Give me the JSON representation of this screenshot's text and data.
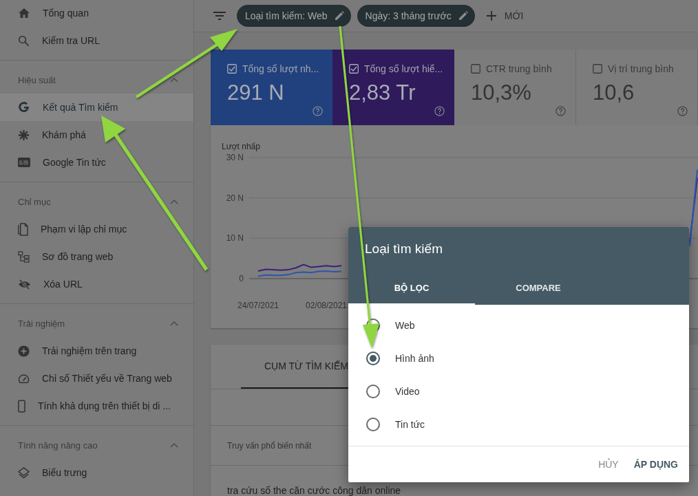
{
  "sidebar": {
    "sections": [
      {
        "items": [
          {
            "label": "Tổng quan",
            "kind": "home",
            "selected": false
          },
          {
            "label": "Kiểm tra URL",
            "kind": "search",
            "selected": false
          }
        ]
      },
      {
        "title": "Hiệu suất",
        "expanded": true,
        "items": [
          {
            "label": "Kết quả Tìm kiếm",
            "kind": "google",
            "selected": true
          },
          {
            "label": "Khám phá",
            "kind": "asterisk",
            "selected": false
          },
          {
            "label": "Google Tin tức",
            "kind": "news",
            "selected": false
          }
        ]
      },
      {
        "title": "Chỉ mục",
        "expanded": true,
        "items": [
          {
            "label": "Phạm vi lập chỉ mục",
            "kind": "pages",
            "selected": false
          },
          {
            "label": "Sơ đồ trang web",
            "kind": "sitemap",
            "selected": false
          },
          {
            "label": "Xóa URL",
            "kind": "eye-off",
            "selected": false
          }
        ]
      },
      {
        "title": "Trải nghiệm",
        "expanded": true,
        "items": [
          {
            "label": "Trải nghiệm trên trang",
            "kind": "experience",
            "selected": false
          },
          {
            "label": "Chỉ số Thiết yếu về Trang web",
            "kind": "gauge",
            "selected": false
          },
          {
            "label": "Tính khả dụng trên thiết bị di ...",
            "kind": "phone",
            "selected": false
          }
        ]
      },
      {
        "title": "Tính năng nâng cao",
        "expanded": true,
        "items": [
          {
            "label": "Biểu trưng",
            "kind": "layers",
            "selected": false
          }
        ]
      }
    ]
  },
  "toolbar": {
    "chips": [
      {
        "label": "Loại tìm kiếm: Web"
      },
      {
        "label": "Ngày: 3 tháng trước"
      }
    ],
    "new_button": "MỚI"
  },
  "metrics": [
    {
      "label": "Tổng số lượt nh...",
      "value": "291 N",
      "checked": true,
      "color": "#21417e"
    },
    {
      "label": "Tổng số lượt hiể...",
      "value": "2,83 Tr",
      "checked": true,
      "color": "#2f1a5c"
    },
    {
      "label": "CTR trung bình",
      "value": "10,3%",
      "checked": false
    },
    {
      "label": "Vị trí trung bình",
      "value": "10,6",
      "checked": false
    }
  ],
  "chart": {
    "chart_data": {
      "type": "line",
      "ylabel": "Lượt nhấp",
      "categories": [
        "24/07/2021",
        null,
        null,
        null,
        null,
        null,
        null,
        null,
        null,
        "02/08/2021",
        null,
        null,
        null,
        null,
        null,
        null,
        null,
        null,
        null,
        null,
        null,
        null,
        null,
        null,
        null,
        null,
        null,
        null,
        null,
        null,
        null,
        null,
        null,
        null,
        null,
        null,
        null,
        null,
        null,
        null,
        null,
        null,
        null,
        null,
        null,
        null,
        null,
        null,
        null,
        null,
        null,
        null,
        null,
        null,
        null,
        null,
        null,
        null,
        null
      ],
      "ylim": [
        0,
        30
      ],
      "yticks": [
        {
          "value": 0,
          "label": "0"
        },
        {
          "value": 10,
          "label": "10 N"
        },
        {
          "value": 20,
          "label": "20 N"
        },
        {
          "value": 30,
          "label": "30 N"
        }
      ],
      "series": [
        {
          "color": "#3a1f7a",
          "values": [
            1.9,
            2.3,
            2.2,
            2.1,
            2.2,
            2.7,
            3.5,
            2.8,
            3.0,
            3.2,
            3.0,
            3.2,
            null,
            null,
            null,
            null,
            null,
            null,
            null,
            null,
            null,
            null,
            null,
            null,
            null,
            null,
            null,
            null,
            null,
            null,
            null,
            null,
            null,
            null,
            null,
            null,
            null,
            null,
            null,
            null,
            null,
            null,
            null,
            null,
            null,
            null,
            null,
            null,
            null,
            null,
            null,
            null,
            null,
            null,
            null,
            null,
            null,
            9.0,
            25.0
          ]
        },
        {
          "color": "#2b55b0",
          "values": [
            0.6,
            0.9,
            0.8,
            0.8,
            1.0,
            1.5,
            1.6,
            1.5,
            1.8,
            1.9,
            1.7,
            1.8,
            null,
            null,
            null,
            null,
            null,
            null,
            null,
            null,
            null,
            null,
            null,
            null,
            null,
            null,
            null,
            null,
            null,
            null,
            null,
            null,
            null,
            null,
            null,
            null,
            null,
            null,
            null,
            null,
            null,
            null,
            null,
            null,
            null,
            null,
            null,
            null,
            null,
            null,
            null,
            null,
            null,
            null,
            null,
            null,
            null,
            8.0,
            27.0
          ]
        }
      ]
    }
  },
  "table": {
    "tabs": [
      {
        "label": "CỤM TỪ TÌM KIẾM",
        "selected": true
      }
    ],
    "column_heading": "Truy vấn phổ biến nhất",
    "rows": [
      {
        "query": "tra cứu số the căn cước công dân online"
      }
    ]
  },
  "dialog": {
    "title": "Loại tìm kiếm",
    "tabs": [
      {
        "label": "BỘ LỌC",
        "selected": true
      },
      {
        "label": "COMPARE",
        "selected": false
      }
    ],
    "options": [
      {
        "label": "Web",
        "selected": false
      },
      {
        "label": "Hình ảnh",
        "selected": true
      },
      {
        "label": "Video",
        "selected": false
      },
      {
        "label": "Tin tức",
        "selected": false
      }
    ],
    "buttons": [
      {
        "label": "HỦY",
        "kind": "cancel"
      },
      {
        "label": "ÁP DỤNG",
        "kind": "apply"
      }
    ]
  }
}
